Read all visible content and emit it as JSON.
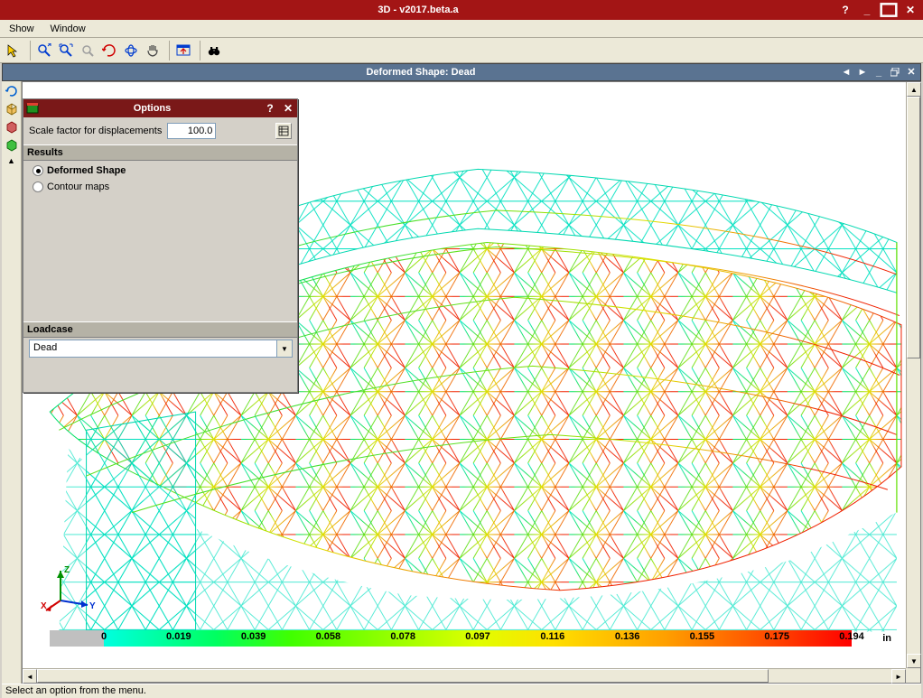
{
  "app": {
    "title": "3D - v2017.beta.a"
  },
  "menubar": {
    "items": [
      "Show",
      "Window"
    ]
  },
  "child_window": {
    "title": "Deformed Shape: Dead"
  },
  "options_dialog": {
    "title": "Options",
    "scale_label": "Scale factor for displacements",
    "scale_value": "100.0",
    "results_header": "Results",
    "radio_deformed": "Deformed Shape",
    "radio_contour": "Contour maps",
    "loadcase_header": "Loadcase",
    "loadcase_value": "Dead"
  },
  "colorbar": {
    "ticks": [
      "0",
      "0.019",
      "0.039",
      "0.058",
      "0.078",
      "0.097",
      "0.116",
      "0.136",
      "0.155",
      "0.175",
      "0.194"
    ],
    "unit": "in"
  },
  "triad": {
    "x": "X",
    "y": "Y",
    "z": "Z"
  },
  "status": {
    "text": "Select an option from the menu."
  }
}
